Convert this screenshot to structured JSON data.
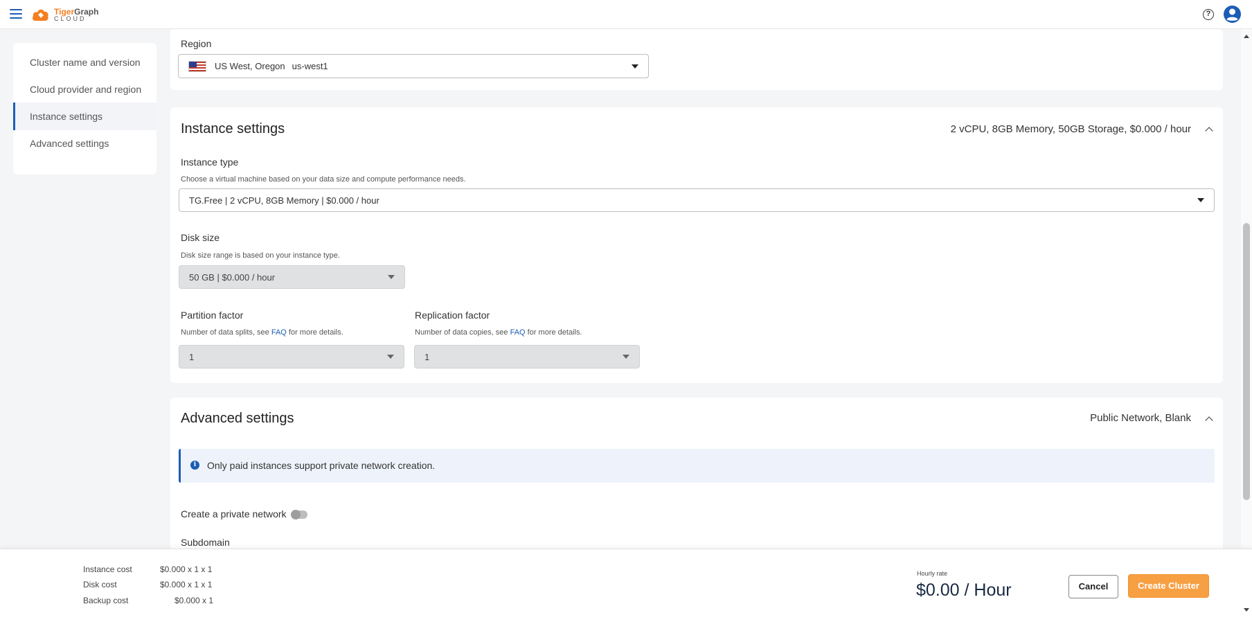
{
  "app": {
    "logo_name": "TigerGraph",
    "logo_name_a": "Tiger",
    "logo_name_b": "Graph",
    "logo_sub": "CLOUD",
    "icons": {
      "menu": "hamburger-icon",
      "help": "help-circle-icon",
      "user": "account-circle-icon"
    }
  },
  "nav": {
    "items": [
      {
        "label": "Cluster name and version",
        "active": false
      },
      {
        "label": "Cloud provider and region",
        "active": false
      },
      {
        "label": "Instance settings",
        "active": true
      },
      {
        "label": "Advanced settings",
        "active": false
      }
    ]
  },
  "region": {
    "label": "Region",
    "value_name": "US West, Oregon",
    "value_code": "us-west1",
    "flag": "us-flag-icon"
  },
  "instance": {
    "title": "Instance settings",
    "summary": "2 vCPU, 8GB Memory, 50GB Storage, $0.000 / hour",
    "type_label": "Instance type",
    "type_hint": "Choose a virtual machine based on your data size and compute performance needs.",
    "type_value": "TG.Free | 2 vCPU, 8GB Memory |  $0.000 / hour",
    "disk_label": "Disk size",
    "disk_hint": "Disk size range is based on your instance type.",
    "disk_value": "50 GB |  $0.000 / hour",
    "partition_label": "Partition factor",
    "partition_hint_pre": "Number of data splits, see ",
    "partition_hint_link": "FAQ",
    "partition_hint_post": " for more details.",
    "partition_value": "1",
    "replication_label": "Replication factor",
    "replication_hint_pre": "Number of data copies, see ",
    "replication_hint_link": "FAQ",
    "replication_hint_post": " for more details.",
    "replication_value": "1"
  },
  "advanced": {
    "title": "Advanced settings",
    "summary": "Public Network, Blank",
    "info_text": "Only paid instances support private network creation.",
    "private_network_label": "Create a private network",
    "private_network_enabled": false,
    "subdomain_label": "Subdomain"
  },
  "footer": {
    "costs": [
      {
        "label": "Instance cost",
        "value": "$0.000 x 1 x 1"
      },
      {
        "label": "Disk cost",
        "value": "$0.000 x 1 x 1"
      },
      {
        "label": "Backup cost",
        "value": "$0.000 x 1"
      }
    ],
    "rate_label": "Hourly rate",
    "rate_value": "$0.00 / Hour",
    "cancel_label": "Cancel",
    "create_label": "Create Cluster"
  },
  "colors": {
    "accent": "#1c5db5",
    "brand_orange": "#f47f20",
    "create_button": "#f7a043",
    "disabled_field": "#dfe1e3",
    "info_bg": "#eef3fb"
  }
}
